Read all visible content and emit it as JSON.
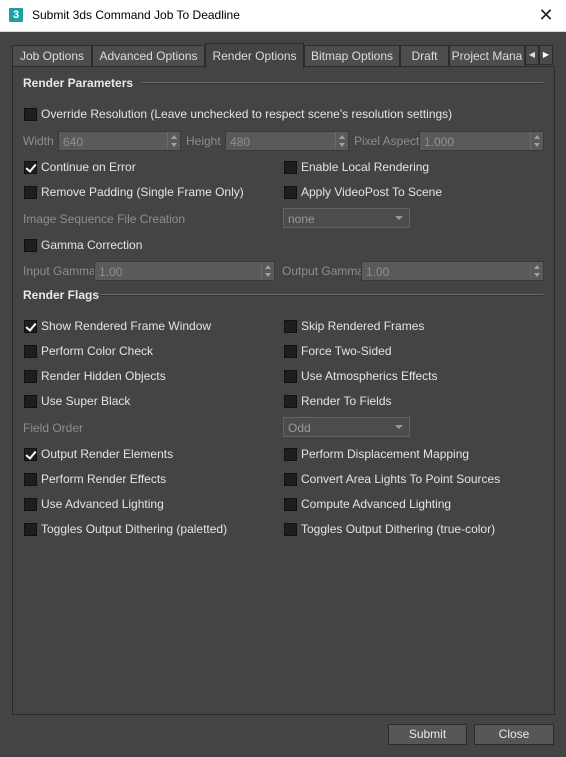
{
  "window": {
    "title": "Submit 3ds Command Job To Deadline",
    "app_icon": "3"
  },
  "tabs": [
    "Job Options",
    "Advanced Options",
    "Render Options",
    "Bitmap Options",
    "Draft",
    "Project Mana"
  ],
  "active_tab": "Render Options",
  "render_parameters": {
    "title": "Render Parameters",
    "override_resolution": {
      "label": "Override Resolution (Leave unchecked to respect scene's resolution settings)",
      "checked": false
    },
    "width": {
      "label": "Width",
      "value": "640"
    },
    "height": {
      "label": "Height",
      "value": "480"
    },
    "pixel_aspect": {
      "label": "Pixel Aspect",
      "value": "1.000"
    },
    "continue_on_error": {
      "label": "Continue on Error",
      "checked": true
    },
    "enable_local_rendering": {
      "label": "Enable Local Rendering",
      "checked": false
    },
    "remove_padding": {
      "label": "Remove Padding (Single Frame Only)",
      "checked": false
    },
    "apply_videopost": {
      "label": "Apply VideoPost To Scene",
      "checked": false
    },
    "image_sequence": {
      "label": "Image Sequence File Creation",
      "value": "none"
    },
    "gamma_correction": {
      "label": "Gamma Correction",
      "checked": false
    },
    "input_gamma": {
      "label": "Input Gamma",
      "value": "1.00"
    },
    "output_gamma": {
      "label": "Output Gamma",
      "value": "1.00"
    }
  },
  "render_flags": {
    "title": "Render Flags",
    "show_rendered_frame_window": {
      "label": "Show Rendered Frame Window",
      "checked": true
    },
    "skip_rendered_frames": {
      "label": "Skip Rendered Frames",
      "checked": false
    },
    "perform_color_check": {
      "label": "Perform Color Check",
      "checked": false
    },
    "force_two_sided": {
      "label": "Force Two-Sided",
      "checked": false
    },
    "render_hidden_objects": {
      "label": "Render Hidden Objects",
      "checked": false
    },
    "use_atmospherics": {
      "label": "Use Atmospherics Effects",
      "checked": false
    },
    "use_super_black": {
      "label": "Use Super Black",
      "checked": false
    },
    "render_to_fields": {
      "label": "Render To Fields",
      "checked": false
    },
    "field_order": {
      "label": "Field Order",
      "value": "Odd"
    },
    "output_render_elements": {
      "label": "Output Render Elements",
      "checked": true
    },
    "perform_displacement_mapping": {
      "label": "Perform Displacement Mapping",
      "checked": false
    },
    "perform_render_effects": {
      "label": "Perform Render Effects",
      "checked": false
    },
    "convert_area_lights": {
      "label": "Convert Area Lights To Point Sources",
      "checked": false
    },
    "use_advanced_lighting": {
      "label": "Use Advanced Lighting",
      "checked": false
    },
    "compute_advanced_lighting": {
      "label": "Compute Advanced Lighting",
      "checked": false
    },
    "dither_paletted": {
      "label": "Toggles Output Dithering (paletted)",
      "checked": false
    },
    "dither_truecolor": {
      "label": "Toggles Output Dithering (true-color)",
      "checked": false
    }
  },
  "buttons": {
    "submit": "Submit",
    "close": "Close"
  },
  "icons": {
    "close": "close-icon",
    "tab_left": "chevron-left-icon",
    "tab_right": "chevron-right-icon"
  }
}
